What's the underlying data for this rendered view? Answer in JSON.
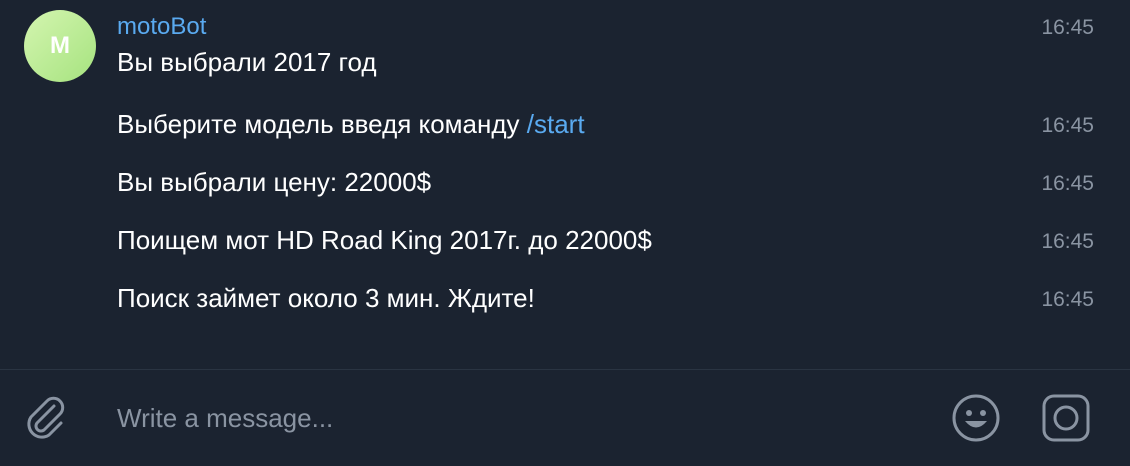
{
  "chat": {
    "avatar_letter": "M",
    "avatar_color": "#b6ec8f",
    "sender": "motoBot",
    "accent": "#5aaaf0",
    "messages": [
      {
        "text": "Вы выбрали 2017 год",
        "time": "16:45"
      },
      {
        "text_prefix": "Выберите модель введя команду ",
        "command": "/start",
        "time": "16:45"
      },
      {
        "text": "Вы выбрали цену: 22000$",
        "time": "16:45"
      },
      {
        "text": "Поищем мот HD Road King 2017г. до 22000$",
        "time": "16:45"
      },
      {
        "text": "Поиск займет около 3 мин. Ждите!",
        "time": "16:45"
      }
    ]
  },
  "composer": {
    "placeholder": "Write a message...",
    "attach_icon": "paperclip-icon",
    "emoji_icon": "smile-icon",
    "camera_icon": "instagram-camera-icon"
  }
}
